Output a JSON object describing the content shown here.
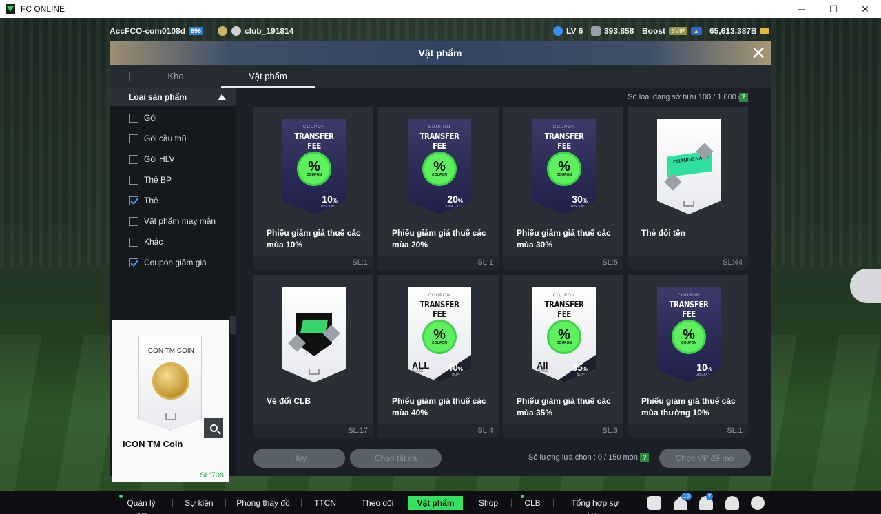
{
  "window": {
    "title": "FC ONLINE",
    "minimize": "─",
    "maximize": "☐",
    "close": "✕"
  },
  "status": {
    "account": "AccFCO-com0108d",
    "account_badge": "896",
    "club": "club_191814",
    "level": "LV 6",
    "points": "393,858",
    "boost_label": "Boost",
    "svip": "SVIP",
    "bp": "65,613.387B"
  },
  "dialog": {
    "title": "Vật phẩm",
    "close": "✕",
    "tabs": [
      {
        "label": "Kho"
      },
      {
        "label": "Vật phẩm"
      }
    ],
    "owned_text": "Số loại đang sở hữu  100 / 1.000 cái",
    "help": "?"
  },
  "sidebar": {
    "header": "Loại sản phẩm",
    "filters": [
      {
        "label": "Gói",
        "checked": false
      },
      {
        "label": "Gói cầu thủ",
        "checked": false
      },
      {
        "label": "Gói HLV",
        "checked": false
      },
      {
        "label": "Thẻ BP",
        "checked": false
      },
      {
        "label": "Thẻ",
        "checked": true
      },
      {
        "label": "Vật phẩm may mắn",
        "checked": false
      },
      {
        "label": "Khác",
        "checked": false
      },
      {
        "label": "Coupon giảm giá",
        "checked": true
      }
    ]
  },
  "preview": {
    "card_title": "ICON TM COIN",
    "name": "ICON TM Coin",
    "qty": "SL:708"
  },
  "items": [
    {
      "name": "Phiếu giảm giá thuế các mùa 10%",
      "qty": "SL:1",
      "coupon": {
        "sub": "COUPON",
        "title": "TRANSFER FEE",
        "value": "10",
        "unit": "%",
        "value_sub": "DISCOUNT"
      }
    },
    {
      "name": "Phiếu giảm giá thuế các mùa 20%",
      "qty": "SL:1",
      "coupon": {
        "sub": "COUPON",
        "title": "TRANSFER FEE",
        "value": "20",
        "unit": "%",
        "value_sub": "DISCOUNT"
      }
    },
    {
      "name": "Phiếu giảm giá thuế các mùa 30%",
      "qty": "SL:5",
      "coupon": {
        "sub": "COUPON",
        "title": "TRANSFER FEE",
        "value": "30",
        "unit": "%",
        "value_sub": "DISCOUNT"
      }
    },
    {
      "name": "Thẻ đổi tên",
      "qty": "SL:44",
      "card_text": "CHANGE NAME"
    },
    {
      "name": "Vé đổi CLB",
      "qty": "SL:17"
    },
    {
      "name": "Phiếu giảm giá thuế các mùa 40%",
      "qty": "SL:4",
      "coupon": {
        "sub": "COUPON",
        "title": "TRANSFER FEE",
        "value": "40",
        "unit": "%",
        "value_sub": "BONUS",
        "all": "ALL",
        "all_sub": "CLASS"
      }
    },
    {
      "name": "Phiếu giảm giá thuế các mùa 35%",
      "qty": "SL:3",
      "coupon": {
        "sub": "COUPON",
        "title": "TRANSFER FEE",
        "value": "35",
        "unit": "%",
        "value_sub": "BONUS",
        "all": "All",
        "all_sub": "CLASS"
      }
    },
    {
      "name": "Phiếu giảm giá thuế các mùa thường 10%",
      "qty": "SL:1",
      "coupon": {
        "sub": "COUPON",
        "title": "TRANSFER FEE",
        "value": "10",
        "unit": "%",
        "value_sub": "DISCOUNT"
      }
    }
  ],
  "badge_pct": "%",
  "badge_sub": "COUPON",
  "footer": {
    "cancel": "Hủy",
    "select_all": "Chọn tất cả",
    "selection_count": "Số lượng lựa chọn : 0 / 150 món",
    "help": "?",
    "choose_vp": "Chọn VP để mở"
  },
  "nav": {
    "items": [
      {
        "label": "Quản lý CT"
      },
      {
        "label": "Sự kiện"
      },
      {
        "label": "Phòng thay đồ"
      },
      {
        "label": "TTCN"
      },
      {
        "label": "Theo dõi"
      },
      {
        "label": "Vật phẩm"
      },
      {
        "label": "Shop"
      },
      {
        "label": "CLB"
      },
      {
        "label": "Tổng hợp sự kiện"
      }
    ],
    "home_badge": "10",
    "bell_badge": "7"
  },
  "colors": {
    "accent_green": "#35e05c",
    "dialog_bg": "#1c1f25",
    "card_bg": "#2a2e35"
  }
}
